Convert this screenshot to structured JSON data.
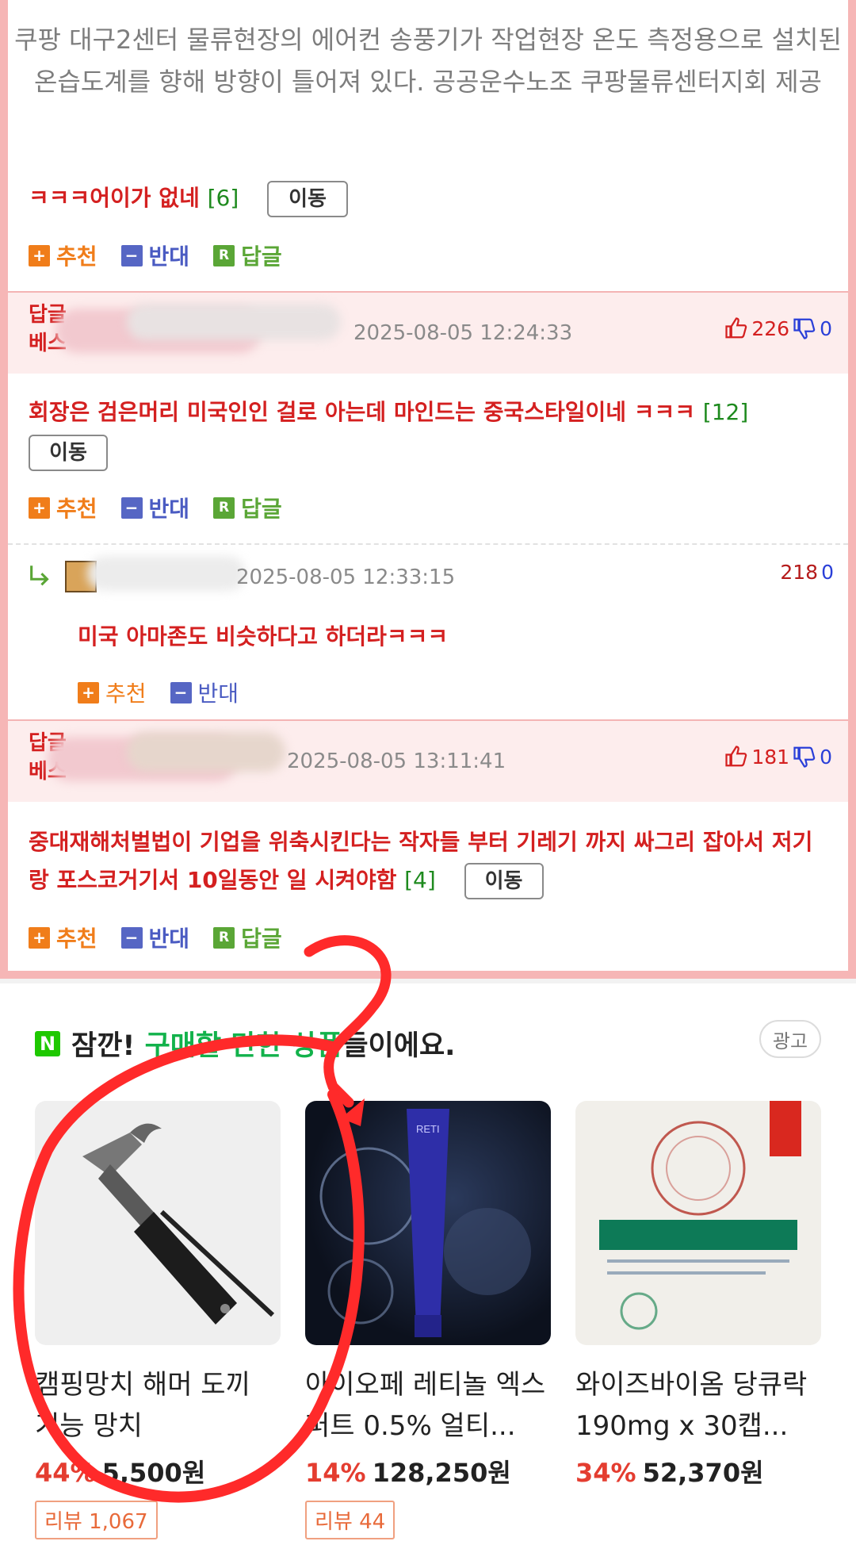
{
  "caption": "쿠팡 대구2센터 물류현장의 에어컨 송풍기가 작업현장 온도 측정용으로 설치된 온습도계를 향해 방향이 틀어져 있다. 공공운수노조 쿠팡물류센터지회 제공",
  "comment_actions": {
    "recommend": "추천",
    "oppose": "반대",
    "reply": "답글",
    "move": "이동"
  },
  "comments": [
    {
      "text": "ㅋㅋㅋ어이가 없네",
      "reply_count": "[6]"
    },
    {
      "best_tag": "답글\n베스",
      "date": "2025-08-05 12:24:33",
      "up": "226",
      "down": "0",
      "text": "회장은 검은머리 미국인인 걸로 아는데 마인드는 중국스타일이네 ㅋㅋㅋ",
      "reply_count": "[12]"
    },
    {
      "date": "2025-08-05 12:33:15",
      "up": "218",
      "down": "0",
      "text": "미국 아마존도 비슷하다고 하더라ㅋㅋㅋ"
    },
    {
      "best_tag": "답글\n베스",
      "date": "2025-08-05 13:11:41",
      "up": "181",
      "down": "0",
      "text": "중대재해처벌법이 기업을 위축시킨다는 작자들 부터 기레기 까지 싸그리 잡아서 저기랑 포스코거기서 10일동안 일 시켜야함",
      "reply_count": "[4]"
    }
  ],
  "products_section": {
    "heading_prefix": "잠깐! ",
    "heading_highlight": "구매할 만한 상품",
    "heading_suffix": "들이에요.",
    "ad_label": "광고",
    "items": [
      {
        "name": "캠핑망치 해머 도끼 기능 망치",
        "discount": "44%",
        "price": "5,500원",
        "review": "리뷰 1,067"
      },
      {
        "name": "아이오페 레티놀 엑스퍼트 0.5% 얼티...",
        "discount": "14%",
        "price": "128,250원",
        "review": "리뷰 44"
      },
      {
        "name": "와이즈바이옴 당큐락 190mg x 30캡...",
        "discount": "34%",
        "price": "52,370원",
        "review": ""
      }
    ]
  },
  "colors": {
    "comment_text": "#d42020",
    "panel_border": "#f6b6b6",
    "highlight": "#12b24b",
    "discount": "#e43d30"
  }
}
